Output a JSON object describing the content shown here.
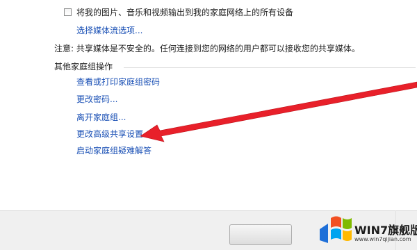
{
  "media": {
    "checkbox_label": "将我的图片、音乐和视频输出到我的家庭网络上的所有设备",
    "checked": false,
    "choose_options_link": "选择媒体流选项..."
  },
  "notice": "注意: 共享媒体是不安全的。任何连接到您的网络的用户都可以接收您的共享媒体。",
  "other_actions": {
    "title": "其他家庭组操作",
    "links": [
      "查看或打印家庭组密码",
      "更改密码...",
      "离开家庭组...",
      "更改高级共享设置...",
      "启动家庭组疑难解答"
    ]
  },
  "annotation": {
    "arrow_color": "#e8202a"
  },
  "watermark": {
    "brand": "WIN7旗舰版",
    "url": "www.win7qijian.com"
  }
}
